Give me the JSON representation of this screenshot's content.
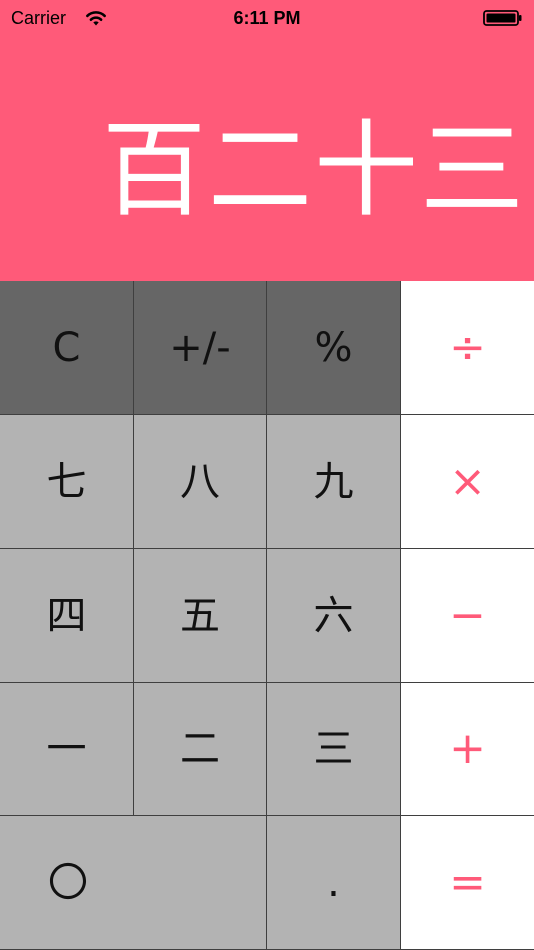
{
  "status_bar": {
    "carrier": "Carrier",
    "time": "6:11 PM",
    "wifi_icon": "wifi-icon",
    "battery_icon": "battery-icon"
  },
  "display": {
    "value": "百二十三",
    "background_color": "#ff5a79",
    "text_color": "#ffffff"
  },
  "keypad": {
    "row1": [
      "C",
      "+/-",
      "%",
      "÷"
    ],
    "row2": [
      "七",
      "八",
      "九",
      "×"
    ],
    "row3": [
      "四",
      "五",
      "六",
      "−"
    ],
    "row4": [
      "一",
      "二",
      "三",
      "+"
    ],
    "row5": [
      "〇",
      ".",
      "="
    ]
  },
  "colors": {
    "function_key_bg": "#666666",
    "number_key_bg": "#b3b3b3",
    "operator_key_bg": "#ffffff",
    "operator_text": "#ff5a79"
  }
}
